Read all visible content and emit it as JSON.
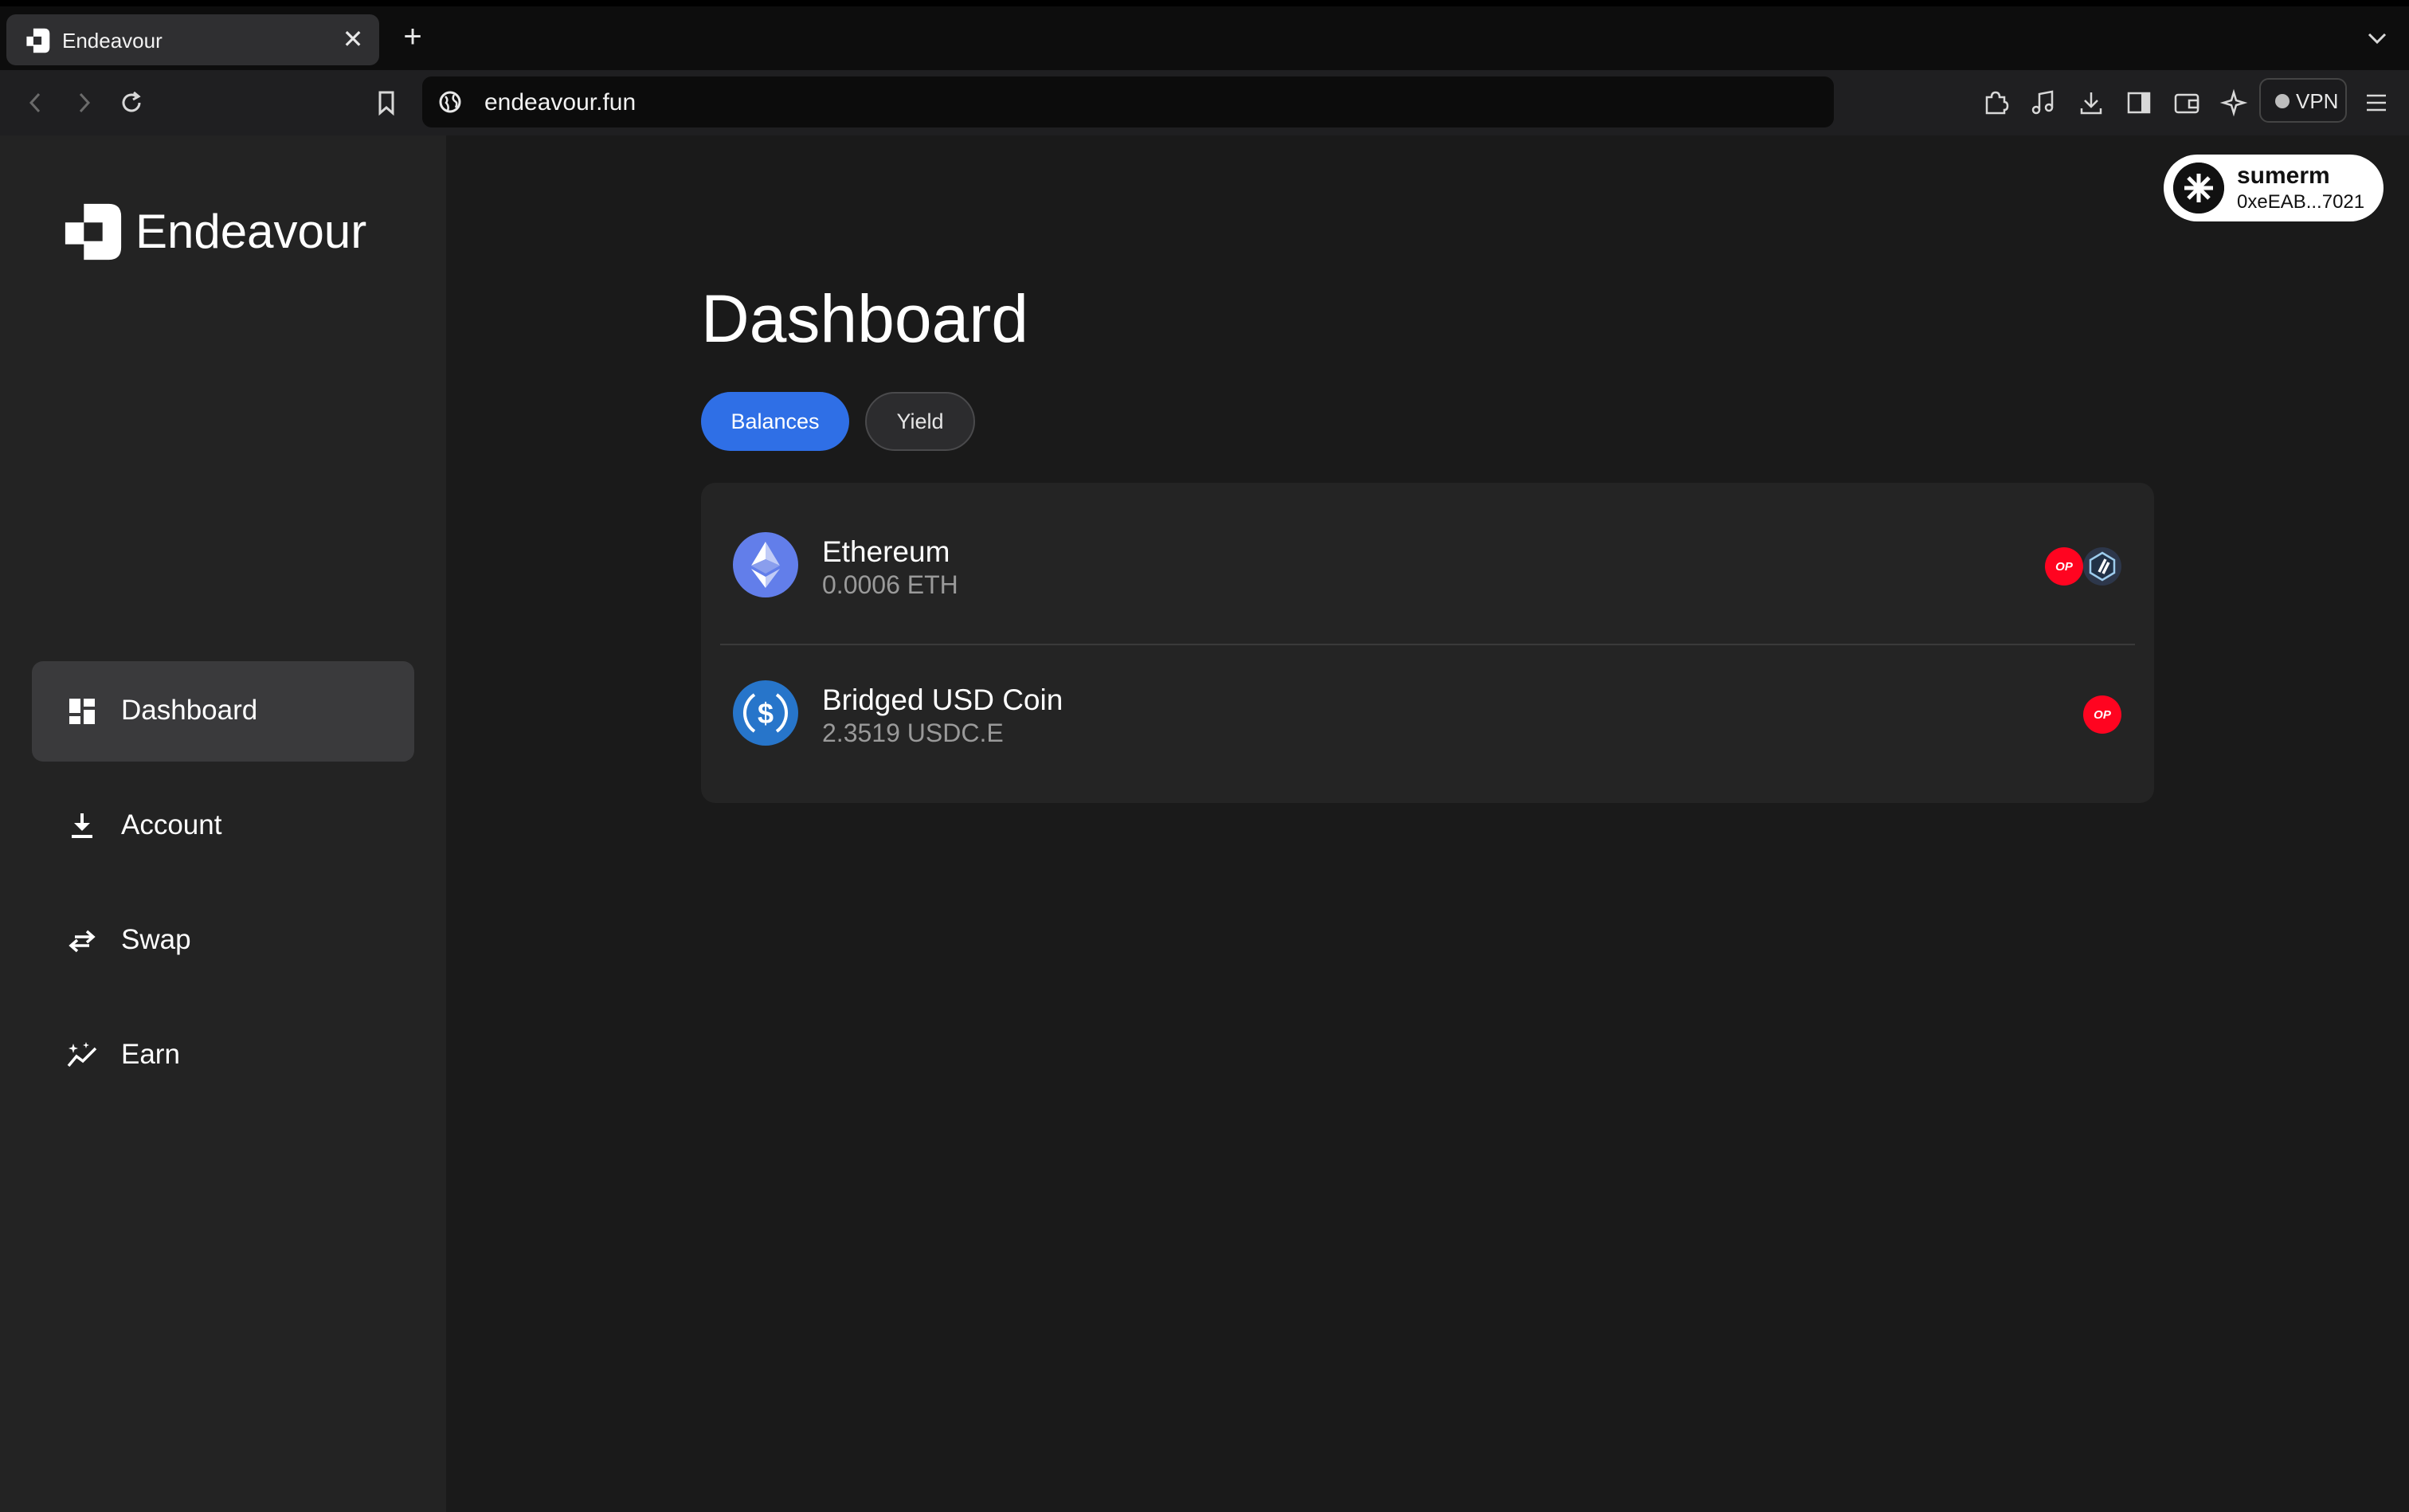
{
  "browser": {
    "tab_title": "Endeavour",
    "tab_close": "✕",
    "new_tab": "+",
    "url": "endeavour.fun",
    "vpn_label": "VPN"
  },
  "app": {
    "brand": "Endeavour",
    "page_title": "Dashboard",
    "tabs": [
      {
        "label": "Balances",
        "active": true
      },
      {
        "label": "Yield",
        "active": false
      }
    ],
    "nav": [
      {
        "label": "Dashboard",
        "icon": "dashboard-icon",
        "active": true
      },
      {
        "label": "Account",
        "icon": "download-icon",
        "active": false
      },
      {
        "label": "Swap",
        "icon": "swap-arrows-icon",
        "active": false
      },
      {
        "label": "Earn",
        "icon": "earn-sparkle-chart-icon",
        "active": false
      }
    ],
    "wallet": {
      "name": "sumerm",
      "address": "0xeEAB...7021"
    },
    "balances": [
      {
        "name": "Ethereum",
        "amount": "0.0006 ETH",
        "icon": "ethereum-icon",
        "chains": [
          "optimism",
          "arbitrum"
        ]
      },
      {
        "name": "Bridged USD Coin",
        "amount": "2.3519 USDC.E",
        "icon": "usdc-icon",
        "chains": [
          "optimism"
        ]
      }
    ],
    "chain_badge_text": "OP"
  },
  "colors": {
    "accent": "#2f6fe6",
    "optimism": "#ff0420",
    "sidebar_bg": "#232323",
    "main_bg": "#1a1a1a",
    "card_bg": "#242424"
  }
}
